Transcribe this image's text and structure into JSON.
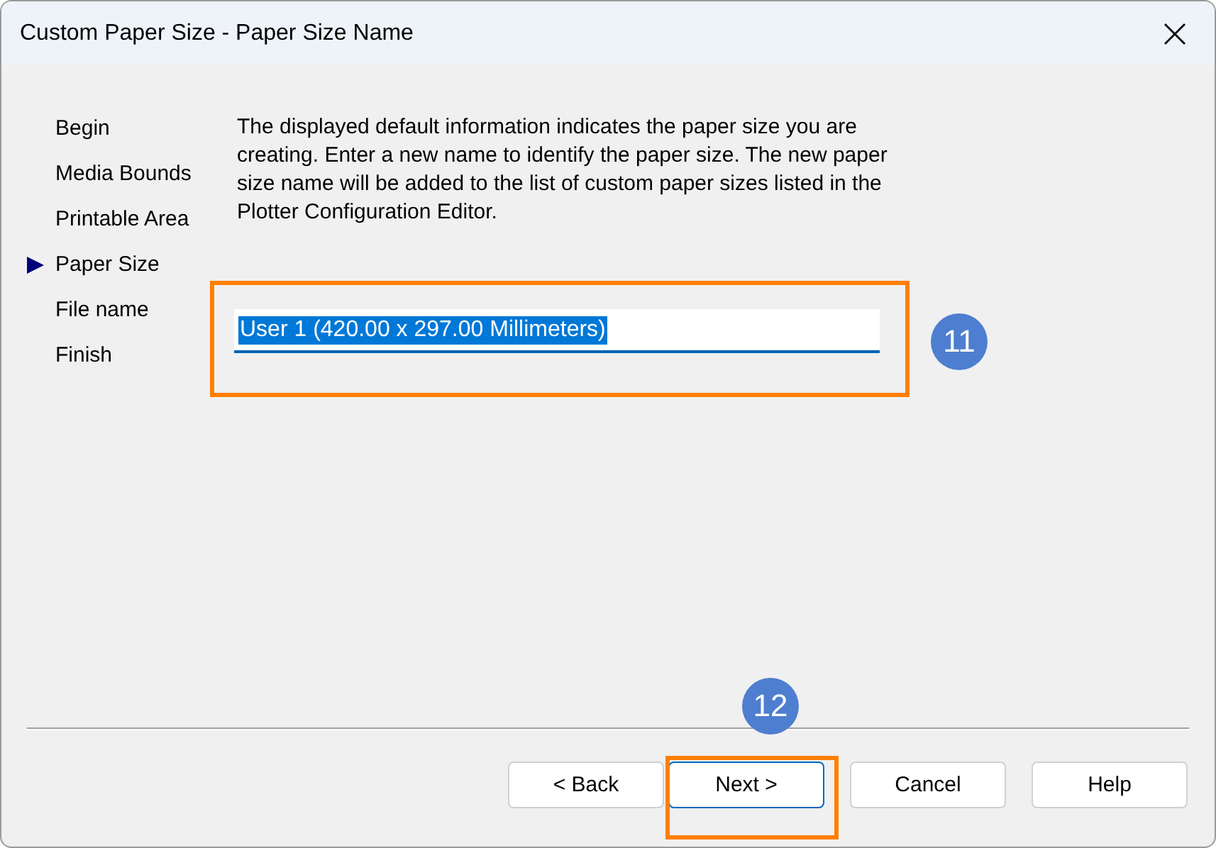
{
  "window": {
    "title": "Custom Paper Size - Paper Size Name"
  },
  "steps": [
    {
      "label": "Begin",
      "selected": false
    },
    {
      "label": "Media Bounds",
      "selected": false
    },
    {
      "label": "Printable Area",
      "selected": false
    },
    {
      "label": "Paper Size",
      "selected": true
    },
    {
      "label": "File name",
      "selected": false
    },
    {
      "label": "Finish",
      "selected": false
    }
  ],
  "description": "The displayed default information indicates the paper size you are creating. Enter a new name to identify the paper size. The new paper size name will be added to the list of custom paper sizes listed in the Plotter Configuration Editor.",
  "name_field": {
    "value": "User 1 (420.00 x 297.00 Millimeters)",
    "text_selected": true
  },
  "buttons": [
    {
      "label": "< Back",
      "default": false
    },
    {
      "label": "Next >",
      "default": true
    },
    {
      "label": "Cancel",
      "default": false
    },
    {
      "label": "Help",
      "default": false
    }
  ],
  "callouts": [
    {
      "label": "11"
    },
    {
      "label": "12"
    }
  ]
}
